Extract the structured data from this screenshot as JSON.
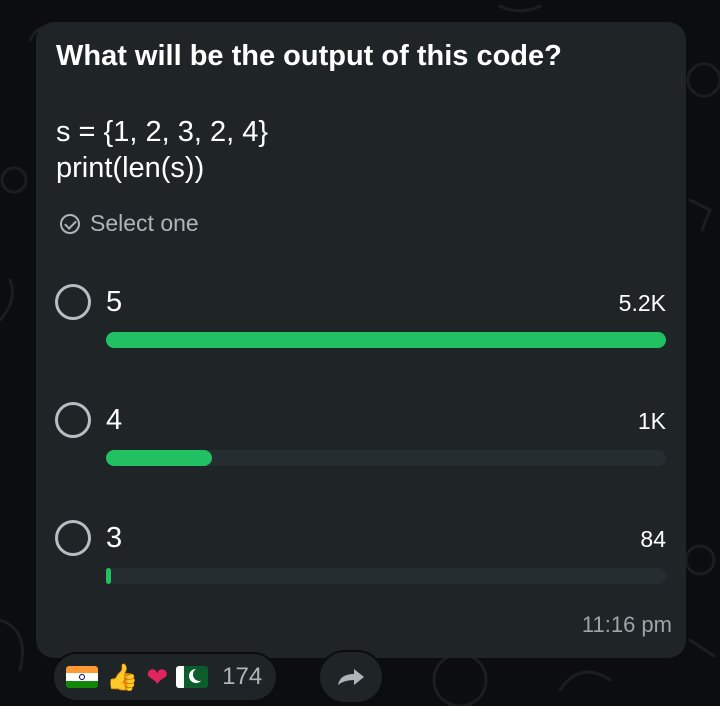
{
  "poll": {
    "question": "What will be the output of this code?",
    "code_lines": [
      "s = {1, 2, 3, 2, 4}",
      "print(len(s))"
    ],
    "select_hint": "Select one",
    "options": [
      {
        "label": "5",
        "count": "5.2K",
        "fraction": 1.0
      },
      {
        "label": "4",
        "count": "1K",
        "fraction": 0.19
      },
      {
        "label": "3",
        "count": "84",
        "fraction": 0.012
      }
    ],
    "time": "11:16 pm"
  },
  "reactions": {
    "emojis": [
      "india-flag-icon",
      "thumbs-up-icon",
      "heart-icon",
      "pakistan-flag-icon"
    ],
    "count": "174"
  },
  "colors": {
    "accent": "#21c063",
    "bubble": "#1f2427",
    "background": "#0b0d0f"
  }
}
